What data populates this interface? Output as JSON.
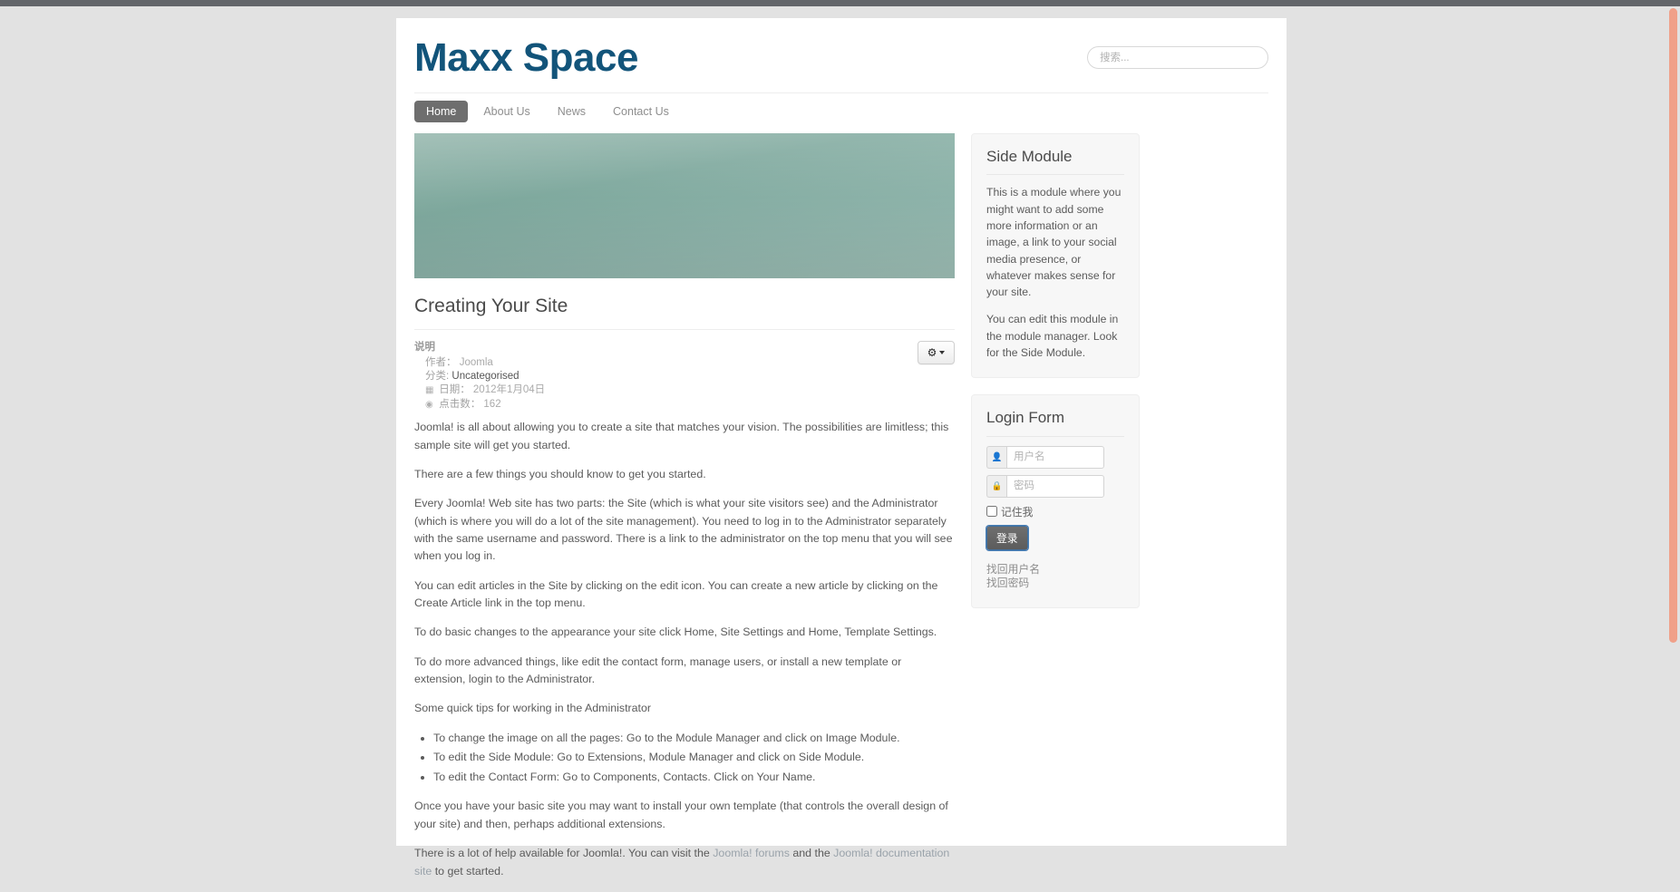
{
  "site": {
    "title": "Maxx Space"
  },
  "search": {
    "placeholder": "搜索...",
    "value": ""
  },
  "nav": {
    "items": [
      {
        "label": "Home",
        "active": true
      },
      {
        "label": "About Us",
        "active": false
      },
      {
        "label": "News",
        "active": false
      },
      {
        "label": "Contact Us",
        "active": false
      }
    ]
  },
  "article": {
    "title": "Creating Your Site",
    "meta": {
      "heading": "说明",
      "author_label": "作者：",
      "author_value": "Joomla",
      "category_label": "分类:",
      "category_value": "Uncategorised",
      "date_label": "日期：",
      "date_value": "2012年1月04日",
      "hits_label": "点击数：",
      "hits_value": "162",
      "calendar_icon": "▦",
      "eye_icon": "◉"
    },
    "actions": {
      "gear_icon": "✷",
      "caret_icon": "▾"
    },
    "paragraphs": [
      "Joomla! is all about allowing you to create a site that matches your vision. The possibilities are limitless; this sample site will get you started.",
      "There are a few things you should know to get you started.",
      "Every Joomla! Web site has two parts: the Site (which is what your site visitors see) and the Administrator (which is where you will do a lot of the site management). You need to log in to the Administrator separately with the same username and password. There is a link to the administrator on the top menu that you will see when you log in.",
      "You can edit articles in the Site by clicking on the edit icon. You can create a new article by clicking on the Create Article link in the top menu.",
      "To do basic changes to the appearance your site click Home, Site Settings and Home, Template Settings.",
      "To do more advanced things, like edit the contact form, manage users, or install a new template or extension, login to the Administrator.",
      "Some quick tips for working in the Administrator"
    ],
    "tips": [
      "To change the image on all the pages: Go to the Module Manager and click on Image Module.",
      "To edit the Side Module: Go to Extensions, Module Manager and click on Side Module.",
      "To edit the Contact Form: Go to Components, Contacts. Click on Your Name."
    ],
    "closing_paragraph": "Once you have your basic site you may want to install your own template (that controls the overall design of your site) and then, perhaps additional extensions.",
    "help_prefix": "There is a lot of help available for Joomla!. You can visit the ",
    "help_link1": "Joomla! forums",
    "help_middle": " and the ",
    "help_link2": "Joomla! documentation site",
    "help_suffix": " to get started."
  },
  "side_module": {
    "title": "Side Module",
    "paragraph1": "This is a module where you might want to add some more information or an image, a link to your social media presence, or whatever makes sense for your site.",
    "paragraph2": "You can edit this module in the module manager. Look for the Side Module."
  },
  "login_form": {
    "title": "Login Form",
    "username_placeholder": "用户名",
    "username_value": "",
    "password_placeholder": "密码",
    "password_value": "",
    "user_icon": "👤",
    "lock_icon": "🔒",
    "remember_label": "记住我",
    "submit_label": "登录",
    "forgot_username": "找回用户名",
    "forgot_password": "找回密码"
  },
  "colors": {
    "brand": "#12547a",
    "nav_active_bg": "#6e6e6e",
    "page_bg": "#e2e2e2",
    "scrollbar": "#f0a089",
    "topbar": "#63666a"
  }
}
